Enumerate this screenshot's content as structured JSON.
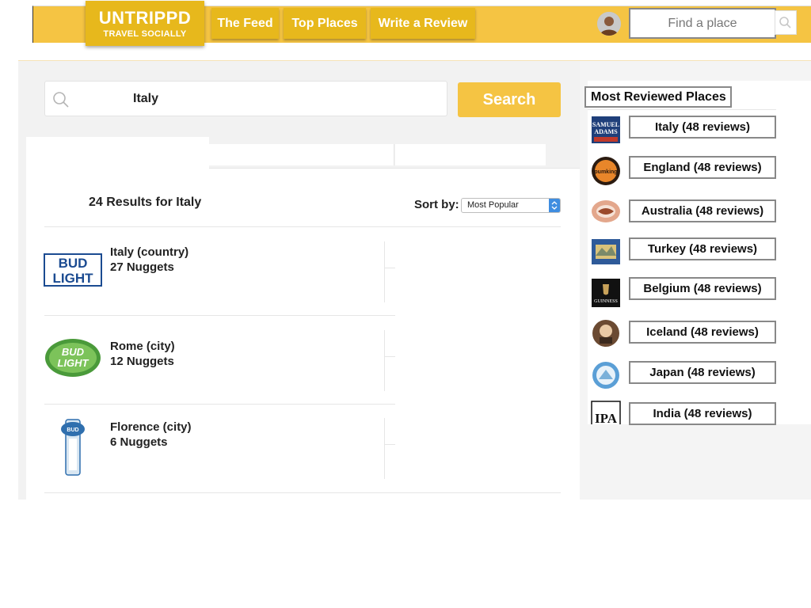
{
  "header": {
    "logo_name": "UNTRIPPD",
    "logo_tagline": "TRAVEL SOCIALLY",
    "nav": [
      "The Feed",
      "Top Places",
      "Write a Review"
    ],
    "find_placeholder": "Find a place",
    "colors": {
      "bar": "#f5c443",
      "button": "#e7b81c"
    }
  },
  "search": {
    "query": "Italy",
    "button_label": "Search",
    "accent": "#f5c443"
  },
  "results": {
    "count_label": "24 Results for Italy",
    "sort_label": "Sort by:",
    "sort_value": "Most Popular",
    "items": [
      {
        "title": "Italy (country)",
        "sub": "27 Nuggets",
        "icon": "bud-light-logo"
      },
      {
        "title": "Rome (city)",
        "sub": "12 Nuggets",
        "icon": "bud-light-lime-logo"
      },
      {
        "title": "Florence (city)",
        "sub": "6 Nuggets",
        "icon": "bud-light-platinum-logo"
      }
    ]
  },
  "sidebar": {
    "heading": "Most Reviewed Places",
    "places": [
      {
        "label": "Italy (48 reviews)",
        "icon": "samuel-adams-logo"
      },
      {
        "label": "England (48 reviews)",
        "icon": "pumking-logo"
      },
      {
        "label": "Australia (48 reviews)",
        "icon": "dogfish-head-logo"
      },
      {
        "label": "Turkey (48 reviews)",
        "icon": "sierra-nevada-logo"
      },
      {
        "label": "Belgium (48 reviews)",
        "icon": "guinness-logo"
      },
      {
        "label": "Iceland (48 reviews)",
        "icon": "monk-logo"
      },
      {
        "label": "Japan (48 reviews)",
        "icon": "oktoberfest-logo"
      },
      {
        "label": "India (48 reviews)",
        "icon": "ipa-logo"
      }
    ]
  }
}
